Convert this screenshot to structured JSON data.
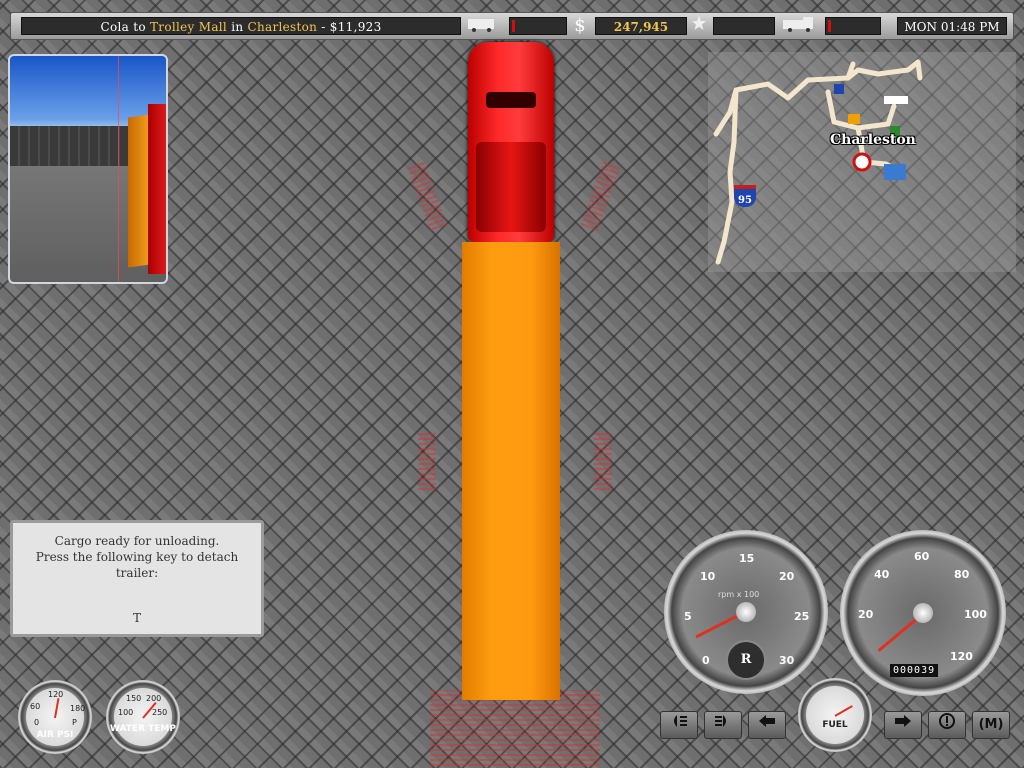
{
  "top_bar": {
    "cargo": "Cola",
    "to_word": "to",
    "destination": "Trolley Mall",
    "in_word": "in",
    "city": "Charleston",
    "separator": "-",
    "payout": "$11,923",
    "money_symbol": "$",
    "money": "247,945",
    "clock": "MON 01:48 PM"
  },
  "minimap": {
    "city_label": "Charleston",
    "highway_shield": "95"
  },
  "message": {
    "line1": "Cargo ready for unloading.",
    "line2": "Press the following key to detach",
    "line3": "trailer:",
    "key": "T"
  },
  "tachometer": {
    "ticks": [
      "0",
      "5",
      "10",
      "15",
      "20",
      "25",
      "30"
    ],
    "unit_label": "rpm x 100",
    "gear": "R"
  },
  "speedometer": {
    "ticks": [
      "20",
      "40",
      "60",
      "80",
      "100",
      "120"
    ],
    "odometer": "000039"
  },
  "air_psi": {
    "label": "AIR PSI",
    "ticks": [
      "0",
      "60",
      "120",
      "180",
      "P"
    ]
  },
  "water_temp": {
    "label": "WATER TEMP",
    "ticks": [
      "100",
      "150",
      "200",
      "250"
    ]
  },
  "fuel": {
    "label": "FUEL"
  },
  "buttons": {
    "map_label": "(M)"
  },
  "colors": {
    "accent_gold": "#f2c550",
    "truck_red": "#ff2a2a",
    "trailer_orange": "#ff9d10"
  }
}
